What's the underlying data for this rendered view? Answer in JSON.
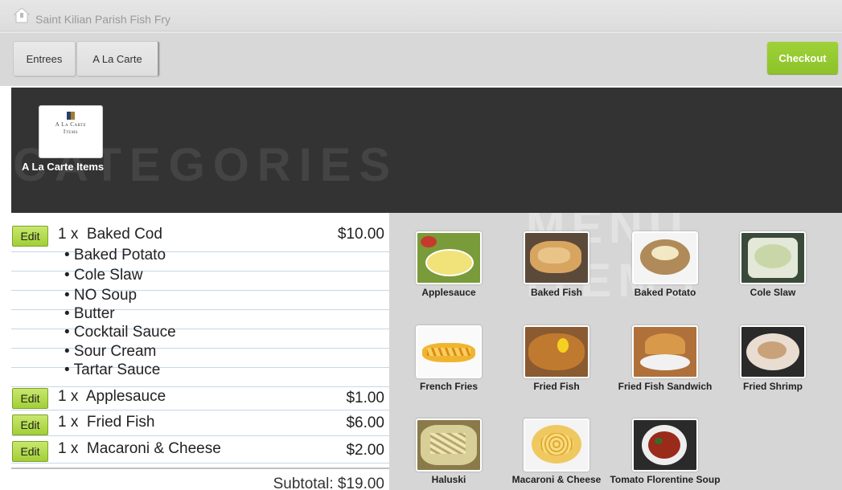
{
  "app": {
    "title": "Saint Kilian Parish Fish Fry"
  },
  "tabs": [
    {
      "label": "Entrees"
    },
    {
      "label": "A La Carte"
    }
  ],
  "checkout_label": "Checkout",
  "categories": {
    "watermark": "CATEGORIES",
    "items": [
      {
        "label": "A La Carte Items",
        "tile_text_1": "A La Carte",
        "tile_text_2": "Items"
      }
    ]
  },
  "order": {
    "edit_label": "Edit",
    "lines": [
      {
        "qty": "1 x",
        "name": "Baked Cod",
        "price": "$10.00",
        "modifiers": [
          "• Baked Potato",
          "• Cole Slaw",
          "• NO Soup",
          "• Butter",
          "• Cocktail Sauce",
          "• Sour Cream",
          "• Tartar Sauce"
        ]
      },
      {
        "qty": "1 x",
        "name": "Applesauce",
        "price": "$1.00"
      },
      {
        "qty": "1 x",
        "name": "Fried Fish",
        "price": "$6.00"
      },
      {
        "qty": "1 x",
        "name": "Macaroni & Cheese",
        "price": "$2.00"
      }
    ],
    "subtotal": "Subtotal: $19.00"
  },
  "menu": {
    "watermark": "MENU ITEMS",
    "items": [
      {
        "label": "Applesauce"
      },
      {
        "label": "Baked Fish"
      },
      {
        "label": "Baked Potato"
      },
      {
        "label": "Cole Slaw"
      },
      {
        "label": "French Fries"
      },
      {
        "label": "Fried Fish"
      },
      {
        "label": "Fried Fish Sandwich"
      },
      {
        "label": "Fried Shrimp"
      },
      {
        "label": "Haluski"
      },
      {
        "label": "Macaroni & Cheese"
      },
      {
        "label": "Tomato Florentine Soup"
      }
    ]
  },
  "colors": {
    "accent_green": "#9fd238",
    "category_bg": "#333333",
    "menu_bg": "#d6d6d6"
  }
}
